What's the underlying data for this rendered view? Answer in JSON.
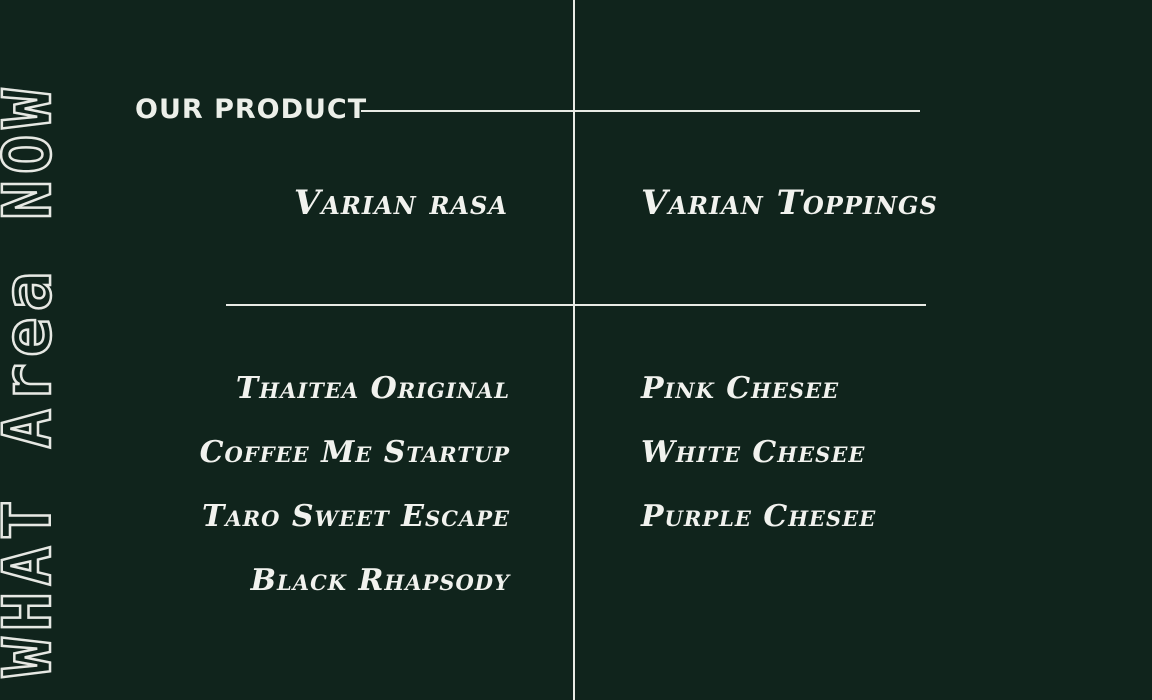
{
  "side_title": "WHAT Area NOW",
  "section_label": "OUR PRODUCT",
  "columns": {
    "flavors": {
      "title": "Varian rasa",
      "items": [
        "Thaitea Original",
        "Coffee Me Startup",
        "Taro Sweet Escape",
        "Black Rhapsody"
      ]
    },
    "toppings": {
      "title": "Varian Toppings",
      "items": [
        "Pink Chesee",
        "White Chesee",
        "Purple Chesee"
      ]
    }
  },
  "colors": {
    "background": "#10241c",
    "text": "#ecefe9",
    "lines": "#e8ebe5"
  }
}
